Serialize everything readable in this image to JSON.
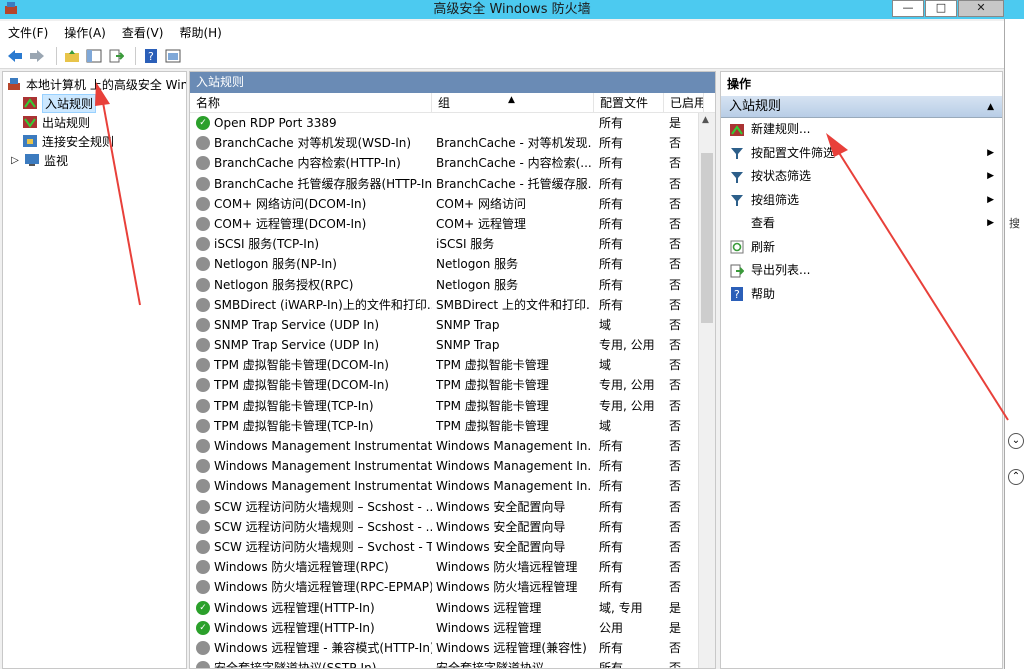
{
  "window": {
    "title": "高级安全 Windows 防火墙",
    "minimize": "—",
    "maximize": "□",
    "close": "✕"
  },
  "menu": [
    "文件(F)",
    "操作(A)",
    "查看(V)",
    "帮助(H)"
  ],
  "tree": {
    "root": "本地计算机 上的高级安全 Windows 防火墙",
    "items": [
      "入站规则",
      "出站规则",
      "连接安全规则",
      "监视"
    ]
  },
  "center": {
    "title": "入站规则",
    "columns": [
      "名称",
      "组",
      "配置文件",
      "已启用"
    ],
    "rows": [
      {
        "name": "Open RDP Port 3389",
        "group": "",
        "profile": "所有",
        "enabled": "是",
        "on": true
      },
      {
        "name": "BranchCache 对等机发现(WSD-In)",
        "group": "BranchCache - 对等机发现...",
        "profile": "所有",
        "enabled": "否",
        "on": false
      },
      {
        "name": "BranchCache 内容检索(HTTP-In)",
        "group": "BranchCache - 内容检索(...",
        "profile": "所有",
        "enabled": "否",
        "on": false
      },
      {
        "name": "BranchCache 托管缓存服务器(HTTP-In)",
        "group": "BranchCache - 托管缓存服...",
        "profile": "所有",
        "enabled": "否",
        "on": false
      },
      {
        "name": "COM+ 网络访问(DCOM-In)",
        "group": "COM+ 网络访问",
        "profile": "所有",
        "enabled": "否",
        "on": false
      },
      {
        "name": "COM+ 远程管理(DCOM-In)",
        "group": "COM+ 远程管理",
        "profile": "所有",
        "enabled": "否",
        "on": false
      },
      {
        "name": "iSCSI 服务(TCP-In)",
        "group": "iSCSI 服务",
        "profile": "所有",
        "enabled": "否",
        "on": false
      },
      {
        "name": "Netlogon 服务(NP-In)",
        "group": "Netlogon 服务",
        "profile": "所有",
        "enabled": "否",
        "on": false
      },
      {
        "name": "Netlogon 服务授权(RPC)",
        "group": "Netlogon 服务",
        "profile": "所有",
        "enabled": "否",
        "on": false
      },
      {
        "name": "SMBDirect (iWARP-In)上的文件和打印...",
        "group": "SMBDirect 上的文件和打印...",
        "profile": "所有",
        "enabled": "否",
        "on": false
      },
      {
        "name": "SNMP Trap Service (UDP In)",
        "group": "SNMP Trap",
        "profile": "域",
        "enabled": "否",
        "on": false
      },
      {
        "name": "SNMP Trap Service (UDP In)",
        "group": "SNMP Trap",
        "profile": "专用, 公用",
        "enabled": "否",
        "on": false
      },
      {
        "name": "TPM 虚拟智能卡管理(DCOM-In)",
        "group": "TPM 虚拟智能卡管理",
        "profile": "域",
        "enabled": "否",
        "on": false
      },
      {
        "name": "TPM 虚拟智能卡管理(DCOM-In)",
        "group": "TPM 虚拟智能卡管理",
        "profile": "专用, 公用",
        "enabled": "否",
        "on": false
      },
      {
        "name": "TPM 虚拟智能卡管理(TCP-In)",
        "group": "TPM 虚拟智能卡管理",
        "profile": "专用, 公用",
        "enabled": "否",
        "on": false
      },
      {
        "name": "TPM 虚拟智能卡管理(TCP-In)",
        "group": "TPM 虚拟智能卡管理",
        "profile": "域",
        "enabled": "否",
        "on": false
      },
      {
        "name": "Windows Management Instrumentati...",
        "group": "Windows Management In...",
        "profile": "所有",
        "enabled": "否",
        "on": false
      },
      {
        "name": "Windows Management Instrumentati...",
        "group": "Windows Management In...",
        "profile": "所有",
        "enabled": "否",
        "on": false
      },
      {
        "name": "Windows Management Instrumentati...",
        "group": "Windows Management In...",
        "profile": "所有",
        "enabled": "否",
        "on": false
      },
      {
        "name": "SCW 远程访问防火墙规则 – Scshost - ...",
        "group": "Windows 安全配置向导",
        "profile": "所有",
        "enabled": "否",
        "on": false
      },
      {
        "name": "SCW 远程访问防火墙规则 – Scshost - ...",
        "group": "Windows 安全配置向导",
        "profile": "所有",
        "enabled": "否",
        "on": false
      },
      {
        "name": "SCW 远程访问防火墙规则 – Svchost - T...",
        "group": "Windows 安全配置向导",
        "profile": "所有",
        "enabled": "否",
        "on": false
      },
      {
        "name": "Windows 防火墙远程管理(RPC)",
        "group": "Windows 防火墙远程管理",
        "profile": "所有",
        "enabled": "否",
        "on": false
      },
      {
        "name": "Windows 防火墙远程管理(RPC-EPMAP)",
        "group": "Windows 防火墙远程管理",
        "profile": "所有",
        "enabled": "否",
        "on": false
      },
      {
        "name": "Windows 远程管理(HTTP-In)",
        "group": "Windows 远程管理",
        "profile": "域, 专用",
        "enabled": "是",
        "on": true
      },
      {
        "name": "Windows 远程管理(HTTP-In)",
        "group": "Windows 远程管理",
        "profile": "公用",
        "enabled": "是",
        "on": true
      },
      {
        "name": "Windows 远程管理 - 兼容模式(HTTP-In)",
        "group": "Windows 远程管理(兼容性)",
        "profile": "所有",
        "enabled": "否",
        "on": false
      },
      {
        "name": "安全套接字隧道协议(SSTP-In)",
        "group": "安全套接字隧道协议",
        "profile": "所有",
        "enabled": "否",
        "on": false
      }
    ]
  },
  "actions": {
    "title": "操作",
    "section": "入站规则",
    "items": [
      {
        "label": "新建规则...",
        "icon": "new-rule-icon",
        "sub": false
      },
      {
        "label": "按配置文件筛选",
        "icon": "filter-icon",
        "sub": true
      },
      {
        "label": "按状态筛选",
        "icon": "filter-icon",
        "sub": true
      },
      {
        "label": "按组筛选",
        "icon": "filter-icon",
        "sub": true
      },
      {
        "label": "查看",
        "icon": "",
        "sub": true
      },
      {
        "label": "刷新",
        "icon": "refresh-icon",
        "sub": false
      },
      {
        "label": "导出列表...",
        "icon": "export-icon",
        "sub": false
      },
      {
        "label": "帮助",
        "icon": "help-icon",
        "sub": false
      }
    ]
  },
  "right_edge_fragment": "搜",
  "colors": {
    "titlebar": "#4ccaf0",
    "pane_header": "#6a8bb5",
    "annotation": "#e8403a"
  }
}
